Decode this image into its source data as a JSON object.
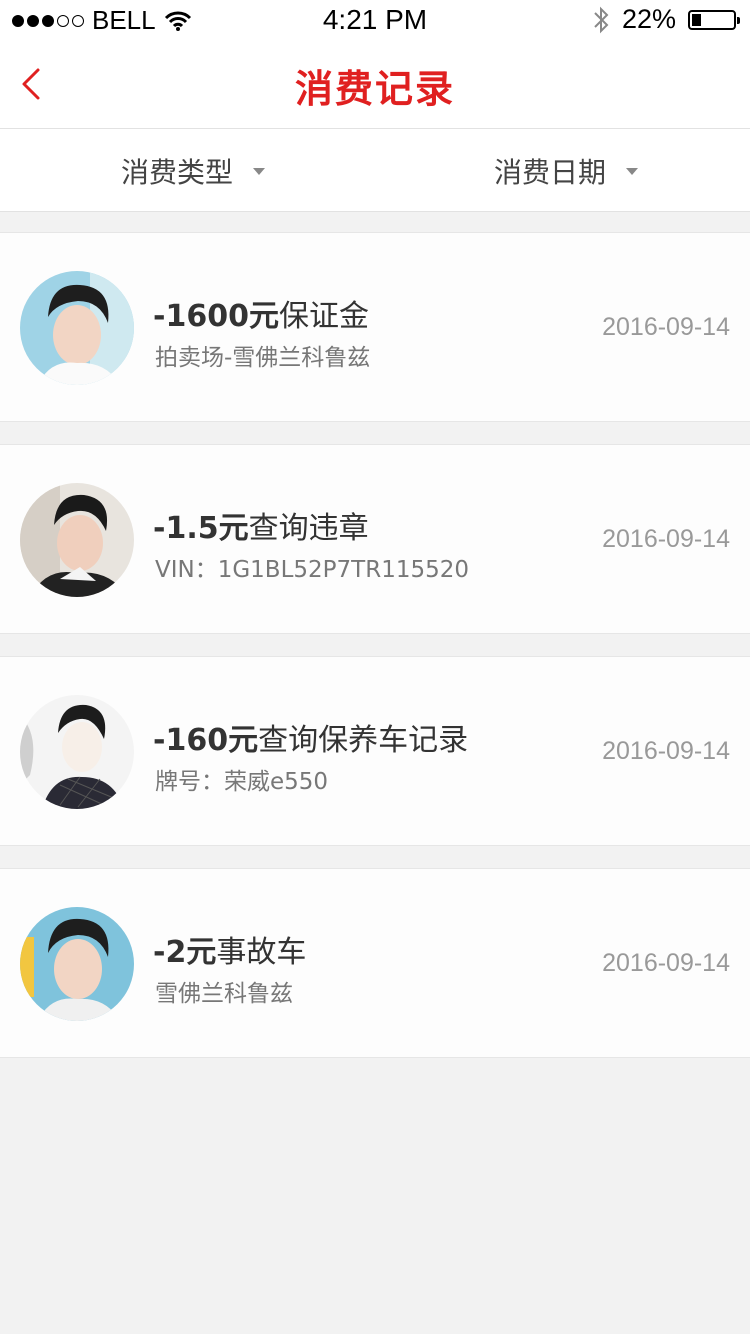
{
  "status_bar": {
    "carrier": "BELL",
    "time": "4:21 PM",
    "battery": "22%",
    "battery_level": 0.22,
    "signal_icon": "signal-dots-icon",
    "wifi_icon": "wifi-icon",
    "bluetooth_icon": "bluetooth-icon"
  },
  "nav": {
    "title": "消费记录",
    "back_icon": "chevron-left-icon",
    "accent_color": "#e02020"
  },
  "filters": {
    "type_label": "消费类型",
    "date_label": "消费日期"
  },
  "records": [
    {
      "amount": "-1600元",
      "item": "保证金",
      "sub": "拍卖场-雪佛兰科鲁兹",
      "date": "2016-09-14"
    },
    {
      "amount": "-1.5元",
      "item": "查询违章",
      "sub": "VIN：1G1BL52P7TR115520",
      "date": "2016-09-14"
    },
    {
      "amount": "-160元",
      "item": "查询保养车记录",
      "sub": "牌号：荣威e550",
      "date": "2016-09-14"
    },
    {
      "amount": "-2元",
      "item": "事故车",
      "sub": "雪佛兰科鲁兹",
      "date": "2016-09-14"
    }
  ]
}
